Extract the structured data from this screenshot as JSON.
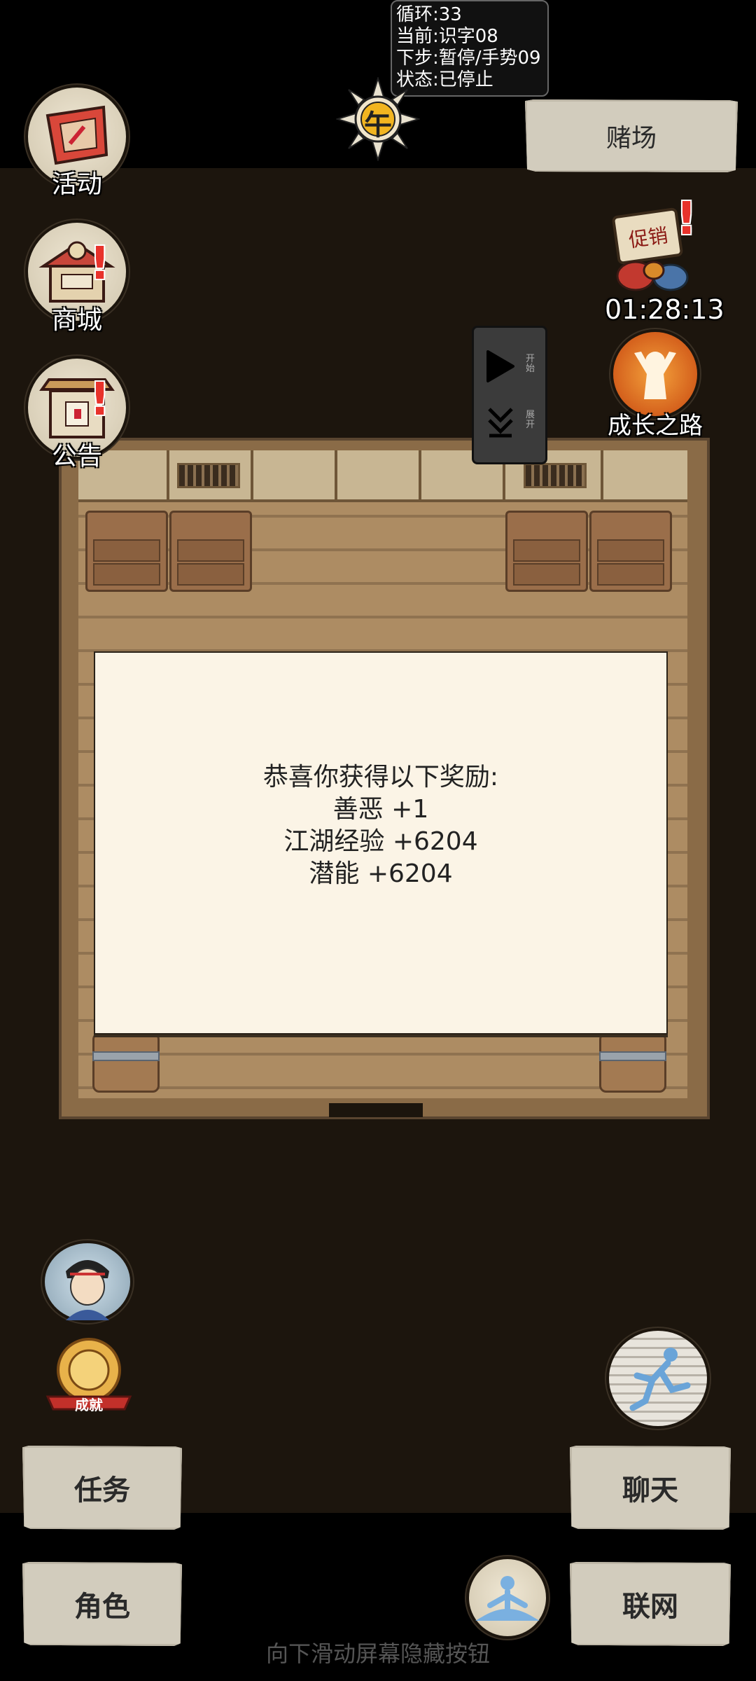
{
  "debug": {
    "loop": "循环:33",
    "current": "当前:识字08",
    "next": "下步:暂停/手势09",
    "status": "状态:已停止"
  },
  "time_badge": "午",
  "left_menu": {
    "activity": "活动",
    "shop": "商城",
    "notice": "公告"
  },
  "casino_button": "赌场",
  "promo": {
    "badge_text": "促销",
    "timer": "01:28:13"
  },
  "growth_road": "成长之路",
  "control_panel": {
    "start_label": "开始",
    "expand_label": "展开"
  },
  "reward_dialog": {
    "title": "恭喜你获得以下奖励:",
    "lines": [
      "善恶 +1",
      "江湖经验 +6204",
      "潜能 +6204"
    ]
  },
  "achievement_label": "成就",
  "bottom_buttons": {
    "task": "任务",
    "chat": "聊天",
    "role": "角色",
    "network": "联网"
  },
  "hint": "向下滑动屏幕隐藏按钮"
}
